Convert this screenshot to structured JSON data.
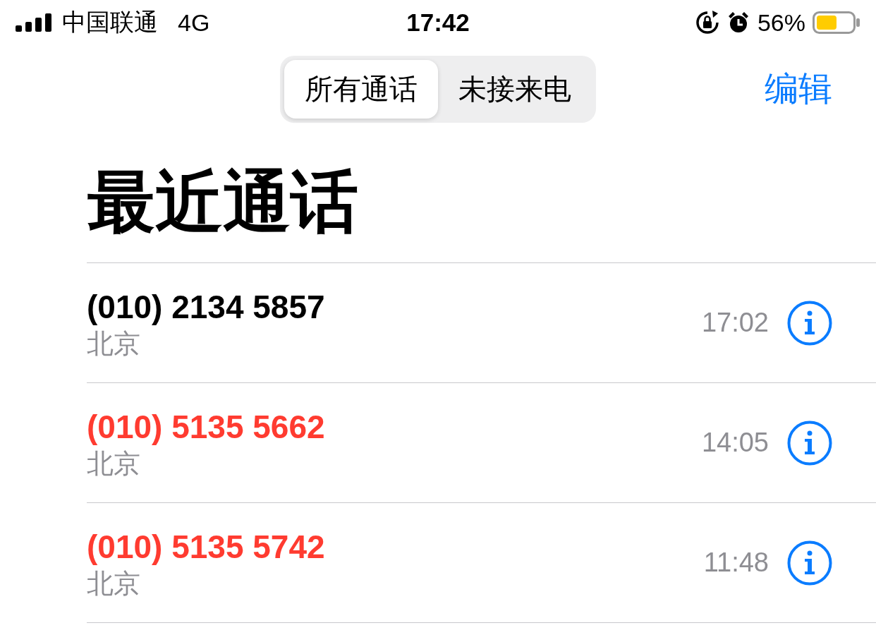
{
  "status_bar": {
    "carrier": "中国联通",
    "network": "4G",
    "time": "17:42",
    "battery": "56%"
  },
  "segments": [
    {
      "label": "所有通话",
      "selected": true
    },
    {
      "label": "未接来电",
      "selected": false
    }
  ],
  "edit_button": "编辑",
  "title": "最近通话",
  "calls": [
    {
      "number": "(010) 2134 5857",
      "location": "北京",
      "time": "17:02",
      "missed": false
    },
    {
      "number": "(010) 5135 5662",
      "location": "北京",
      "time": "14:05",
      "missed": true
    },
    {
      "number": "(010) 5135 5742",
      "location": "北京",
      "time": "11:48",
      "missed": true
    }
  ]
}
